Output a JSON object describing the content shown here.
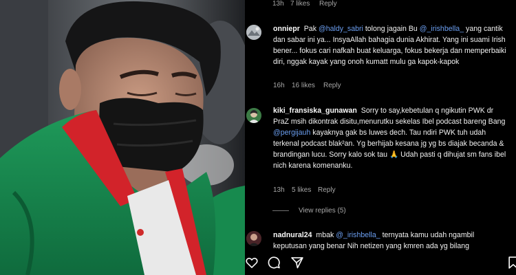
{
  "top_meta": {
    "time": "13h",
    "likes": "7 likes",
    "reply": "Reply"
  },
  "comments": [
    {
      "username": "onniepr",
      "parts": [
        {
          "t": "Pak ",
          "m": false
        },
        {
          "t": "@haldy_sabri",
          "m": true
        },
        {
          "t": " tolong jagain Bu ",
          "m": false
        },
        {
          "t": "@_irishbella_",
          "m": true
        },
        {
          "t": " yang cantik dan sabar ini ya... InsyaAllah bahagia dunia Akhirat. Yang ini suami Irish bener... fokus cari nafkah buat keluarga, fokus bekerja dan memperbaiki diri, nggak kayak yang onoh kumatt mulu ga kapok-kapok",
          "m": false
        }
      ],
      "time": "16h",
      "likes": "16 likes",
      "reply": "Reply",
      "avatar": "avatar-gray"
    },
    {
      "username": "kiki_fransiska_gunawan",
      "parts": [
        {
          "t": "Sorry to say,kebetulan q ngikutin PWK dr PraZ msih dikontrak disitu,menurutku sekelas Ibel podcast bareng Bang ",
          "m": false
        },
        {
          "t": "@pergijauh",
          "m": true
        },
        {
          "t": " kayaknya gak bs luwes dech. Tau ndiri PWK tuh udah terkenal podcast blak²an. Yg berhijab kesana jg yg bs diajak becanda & brandingan lucu. Sorry kalo sok tau 🙏 Udah pasti q dihujat sm fans ibel nich karena komenanku.",
          "m": false
        }
      ],
      "time": "13h",
      "likes": "5 likes",
      "reply": "Reply",
      "avatar": "avatar-green"
    },
    {
      "username": "nadnural24",
      "parts": [
        {
          "t": "mbak ",
          "m": false
        },
        {
          "t": "@_irishbella_",
          "m": true
        },
        {
          "t": " ternyata kamu udah ngambil keputusan yang benar Nih netizen yang kmren ada yg bilang",
          "m": false
        }
      ],
      "avatar": "avatar-dark"
    }
  ],
  "view_replies": "View replies (5)",
  "icons": [
    "heart-icon",
    "comment-icon",
    "share-icon",
    "bookmark-icon"
  ]
}
